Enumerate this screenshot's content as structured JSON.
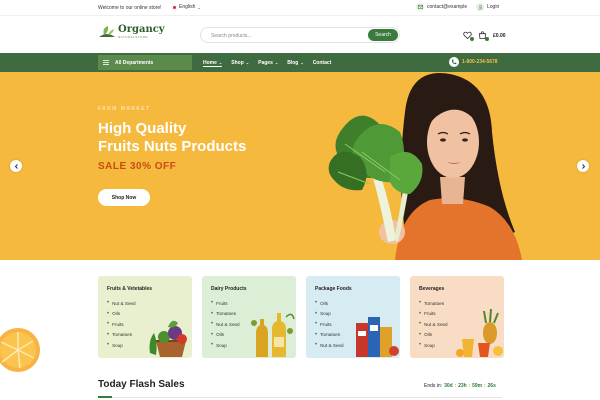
{
  "topbar": {
    "welcome": "Welcome to our online store!",
    "language": "English",
    "contact": "contact@example",
    "login": "Login"
  },
  "header": {
    "logo_name": "Organcy",
    "logo_sub": "NATURALSTORE",
    "search_placeholder": "Search products...",
    "search_button": "Search",
    "cart_total": "£0.00"
  },
  "nav": {
    "departments": "All Departments",
    "items": [
      {
        "label": "Home",
        "has_caret": true,
        "active": true
      },
      {
        "label": "Shop",
        "has_caret": true
      },
      {
        "label": "Pages",
        "has_caret": true
      },
      {
        "label": "Blog",
        "has_caret": true
      },
      {
        "label": "Contact",
        "has_caret": false
      }
    ],
    "phone": "1-800-234-5678"
  },
  "hero": {
    "kicker": "FARM MARKET",
    "title_line1": "High Quality",
    "title_line2": "Fruits Nuts Products",
    "sale": "SALE 30% OFF",
    "cta": "Shop Now"
  },
  "categories": [
    {
      "title": "Fruits & Vetetables",
      "items": [
        "Nut & Seed",
        "Oils",
        "Fruits",
        "Tomatoes",
        "Soup"
      ],
      "color": "#e8f0cf"
    },
    {
      "title": "Dairy Products",
      "items": [
        "Fruits",
        "Tomatoes",
        "Nut & Seed",
        "Oils",
        "Soup"
      ],
      "color": "#dcefd6"
    },
    {
      "title": "Package Foods",
      "items": [
        "Oils",
        "Soup",
        "Fruits",
        "Tomatoes",
        "Nut & Seed"
      ],
      "color": "#d6ebf2"
    },
    {
      "title": "Beverages",
      "items": [
        "Tomatoes",
        "Fruits",
        "Nut & Seed",
        "Oils",
        "Soup"
      ],
      "color": "#f8dcc4"
    }
  ],
  "flash": {
    "title": "Today Flash Sales",
    "ends_label": "Ends in:",
    "days": "30d",
    "hours": "23h",
    "minutes": "59m",
    "seconds": "26s"
  },
  "colors": {
    "brand_green": "#3e6b3f",
    "hero_yellow": "#f5b93e",
    "sale_orange": "#c94b12",
    "phone_yellow": "#f2c14e"
  }
}
